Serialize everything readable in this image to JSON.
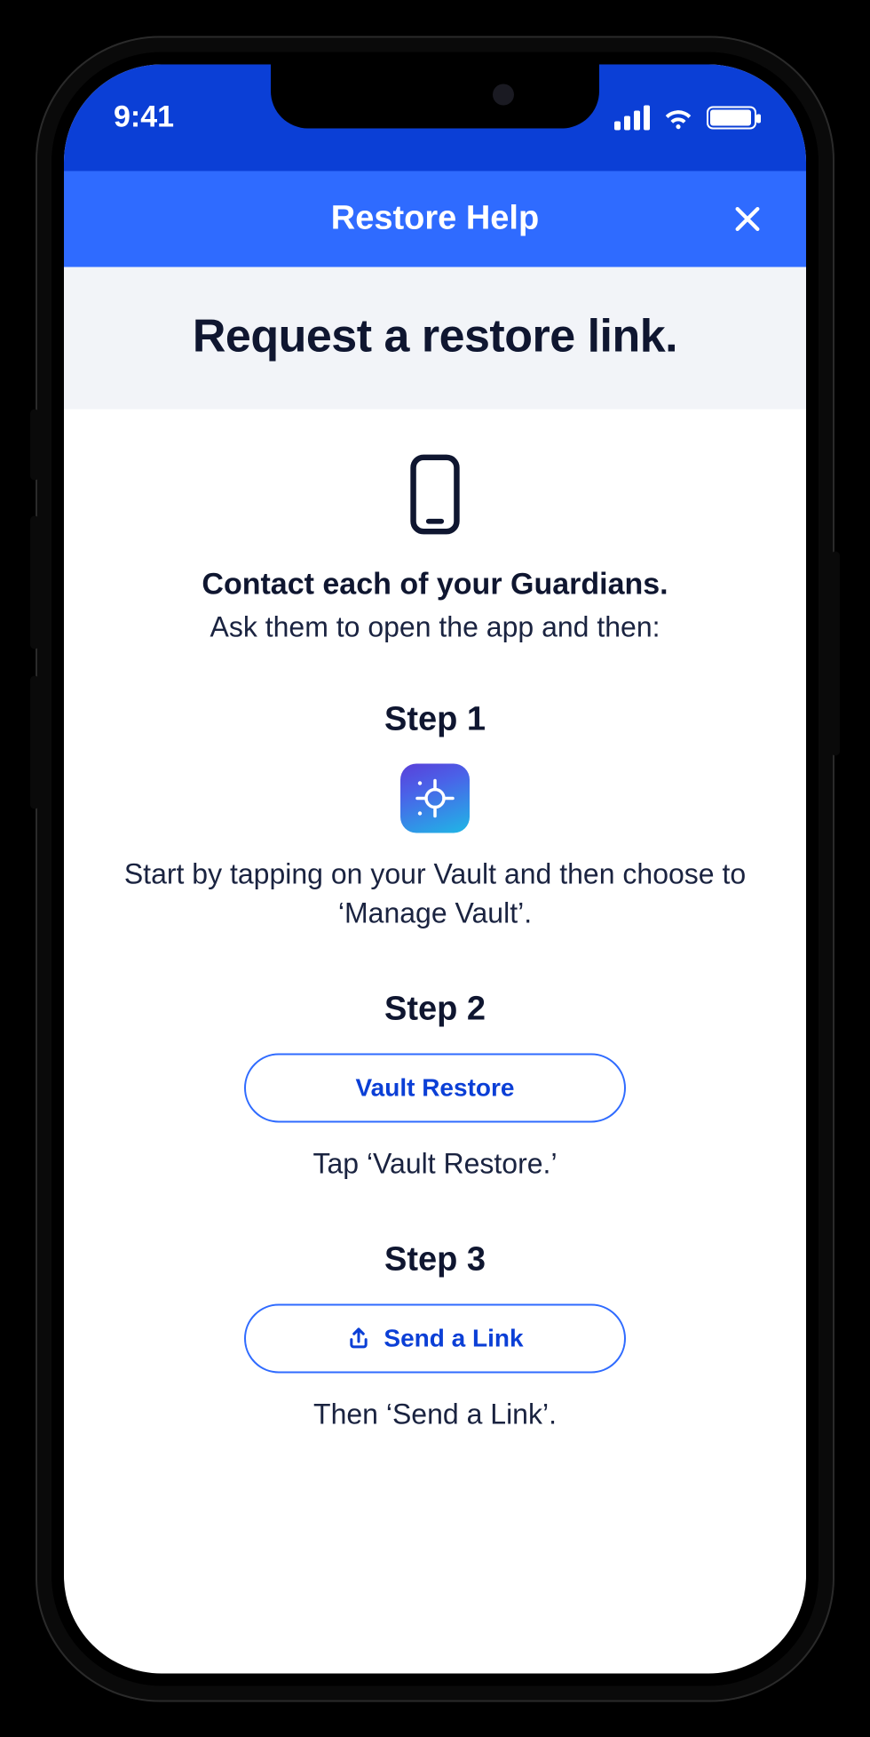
{
  "statusbar": {
    "time": "9:41"
  },
  "nav": {
    "title": "Restore Help"
  },
  "page": {
    "heading": "Request a restore link."
  },
  "intro": {
    "bold": "Contact each of your Guardians.",
    "sub": "Ask them to open the app and then:"
  },
  "step1": {
    "title": "Step 1",
    "text": "Start by tapping on your Vault and then choose to ‘Manage Vault’."
  },
  "step2": {
    "title": "Step 2",
    "button": "Vault Restore",
    "text": "Tap ‘Vault Restore.’"
  },
  "step3": {
    "title": "Step 3",
    "button": "Send a Link",
    "text": "Then ‘Send a Link’."
  }
}
